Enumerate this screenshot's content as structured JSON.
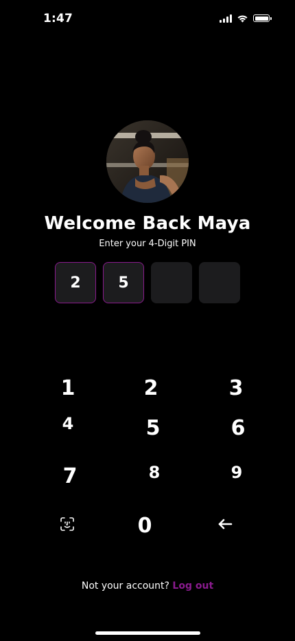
{
  "status_bar": {
    "time": "1:47"
  },
  "profile": {
    "avatar_alt": "Maya",
    "title": "Welcome Back Maya",
    "prompt": "Enter your 4-Digit PIN"
  },
  "pin": {
    "digits": [
      "2",
      "5",
      "",
      ""
    ],
    "filled_border_color": "#8b1b8f"
  },
  "keypad": {
    "keys": [
      "1",
      "2",
      "3",
      "4",
      "5",
      "6",
      "7",
      "8",
      "9",
      "0"
    ],
    "face_id_icon": "face-id-icon",
    "backspace_icon": "arrow-left-icon"
  },
  "footer": {
    "question": "Not your account?",
    "logout_label": "Log out",
    "accent_color": "#8b1b8f"
  }
}
